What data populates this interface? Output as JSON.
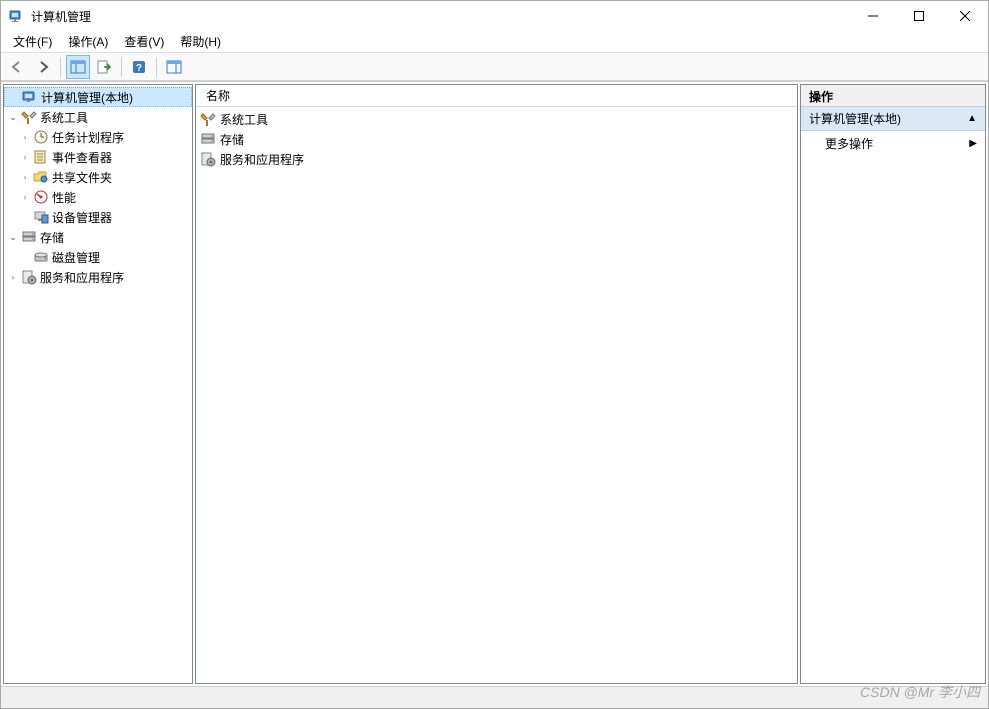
{
  "window": {
    "title": "计算机管理"
  },
  "menu": {
    "file": "文件(F)",
    "action": "操作(A)",
    "view": "查看(V)",
    "help": "帮助(H)"
  },
  "tree": {
    "root": "计算机管理(本地)",
    "system_tools": "系统工具",
    "task_scheduler": "任务计划程序",
    "event_viewer": "事件查看器",
    "shared_folders": "共享文件夹",
    "performance": "性能",
    "device_manager": "设备管理器",
    "storage": "存储",
    "disk_management": "磁盘管理",
    "services_apps": "服务和应用程序"
  },
  "center": {
    "header": "名称",
    "items": {
      "system_tools": "系统工具",
      "storage": "存储",
      "services_apps": "服务和应用程序"
    }
  },
  "actions": {
    "header": "操作",
    "section": "计算机管理(本地)",
    "more": "更多操作"
  },
  "watermark": "CSDN @Mr 李小四"
}
